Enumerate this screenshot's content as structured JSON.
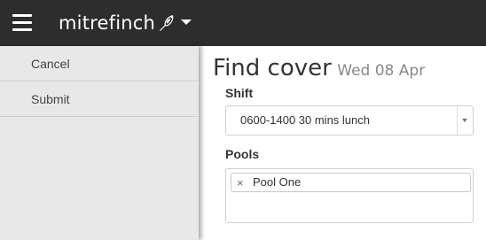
{
  "app": {
    "brand": "mitrefinch"
  },
  "icons": {
    "menu": "hamburger-icon",
    "brand_mark": "bird-icon",
    "brand_menu": "caret-down-icon"
  },
  "sidebar": {
    "items": [
      {
        "label": "Cancel"
      },
      {
        "label": "Submit"
      }
    ]
  },
  "page": {
    "title": "Find cover",
    "date": "Wed 08 Apr"
  },
  "shift": {
    "label": "Shift",
    "value": "0600-1400 30 mins lunch"
  },
  "pools": {
    "label": "Pools",
    "selected": [
      {
        "label": "Pool One",
        "remove_symbol": "×"
      }
    ]
  },
  "colors": {
    "topbar": "#2d2d2d",
    "sidebar": "#e8e8e8"
  }
}
